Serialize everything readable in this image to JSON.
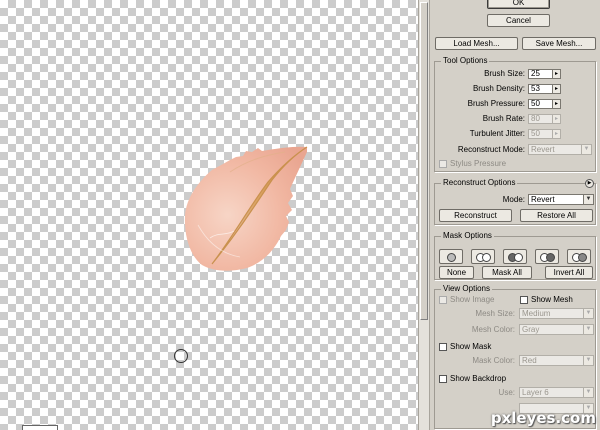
{
  "dialog": {
    "ok_label": "OK",
    "cancel_label": "Cancel"
  },
  "mesh": {
    "load_label": "Load Mesh...",
    "save_label": "Save Mesh..."
  },
  "tool_options": {
    "title": "Tool Options",
    "brush_size": {
      "label": "Brush Size:",
      "value": "25"
    },
    "brush_density": {
      "label": "Brush Density:",
      "value": "53"
    },
    "brush_pressure": {
      "label": "Brush Pressure:",
      "value": "50"
    },
    "brush_rate": {
      "label": "Brush Rate:",
      "value": "80"
    },
    "turbulent_jitter": {
      "label": "Turbulent Jitter:",
      "value": "50"
    },
    "reconstruct_mode": {
      "label": "Reconstruct Mode:",
      "value": "Revert"
    },
    "stylus_pressure_label": "Stylus Pressure"
  },
  "reconstruct_options": {
    "title": "Reconstruct Options",
    "mode_label": "Mode:",
    "mode_value": "Revert",
    "reconstruct_label": "Reconstruct",
    "restore_all_label": "Restore All"
  },
  "mask_options": {
    "title": "Mask Options",
    "none_label": "None",
    "mask_all_label": "Mask All",
    "invert_all_label": "Invert All"
  },
  "view_options": {
    "title": "View Options",
    "show_image_label": "Show Image",
    "show_mesh_label": "Show Mesh",
    "mesh_size_label": "Mesh Size:",
    "mesh_size_value": "Medium",
    "mesh_color_label": "Mesh Color:",
    "mesh_color_value": "Gray",
    "show_mask_label": "Show Mask",
    "mask_color_label": "Mask Color:",
    "mask_color_value": "Red",
    "show_backdrop_label": "Show Backdrop",
    "use_label": "Use:",
    "use_value": "Layer 6"
  },
  "watermark": "pxleyes.com",
  "colors": {
    "panel": "#d4d0c8",
    "petal": "#f2b9a4",
    "petal_vein": "#d9a05c"
  }
}
